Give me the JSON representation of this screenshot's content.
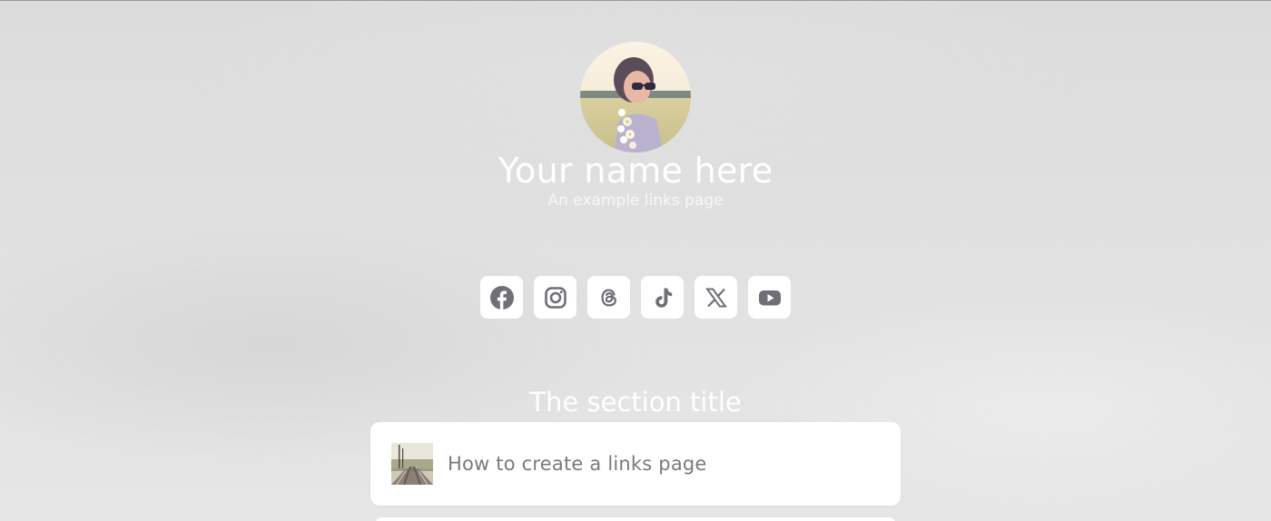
{
  "profile": {
    "name": "Your name here",
    "tagline": "An example links page"
  },
  "socials": [
    {
      "icon": "facebook-icon"
    },
    {
      "icon": "instagram-icon"
    },
    {
      "icon": "threads-icon"
    },
    {
      "icon": "tiktok-icon"
    },
    {
      "icon": "x-icon"
    },
    {
      "icon": "youtube-icon"
    }
  ],
  "section": {
    "title": "The section title",
    "links": [
      {
        "label": "How to create a links page"
      }
    ]
  },
  "colors": {
    "icon": "#6f6f78",
    "card": "#ffffff",
    "title_text": "#ffffff",
    "link_text": "#7a7a7e"
  }
}
